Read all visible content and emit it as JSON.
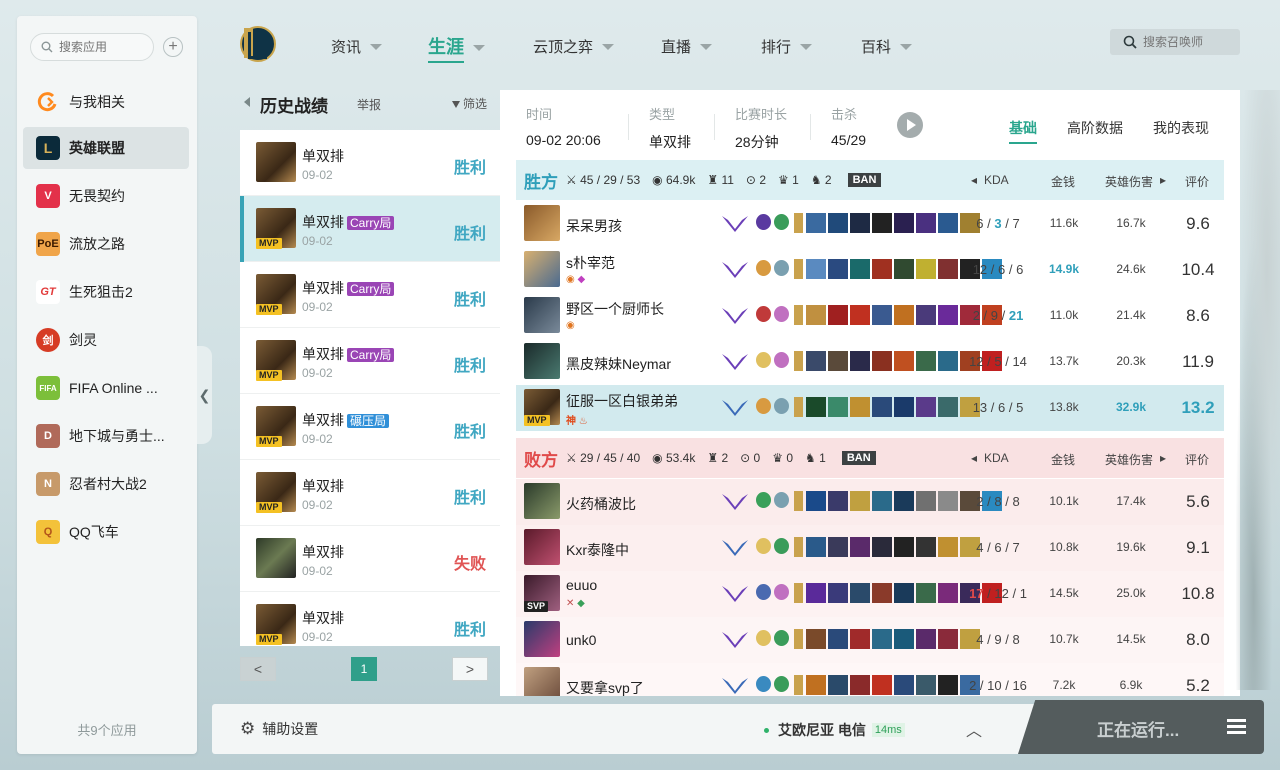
{
  "sidebar": {
    "search_placeholder": "搜索应用",
    "apps": [
      {
        "label": "与我相关",
        "icon": "ring-icon",
        "color": "#ff8a1e"
      },
      {
        "label": "英雄联盟",
        "icon": "lol-icon",
        "color": "#c8a24d"
      },
      {
        "label": "无畏契约",
        "icon": "valorant-icon",
        "color": "#e3314a"
      },
      {
        "label": "流放之路",
        "icon": "poe-icon",
        "color": "#e8a04a"
      },
      {
        "label": "生死狙击2",
        "icon": "sniper-icon",
        "color": "#e23b3b"
      },
      {
        "label": "剑灵",
        "icon": "blade-soul-icon",
        "color": "#d63c25"
      },
      {
        "label": "FIFA Online ...",
        "icon": "fifa-icon",
        "color": "#7cbf3a"
      },
      {
        "label": "地下城与勇士...",
        "icon": "dnf-icon",
        "color": "#b06a5a"
      },
      {
        "label": "忍者村大战2",
        "icon": "ninja-icon",
        "color": "#c79a6a"
      },
      {
        "label": "QQ飞车",
        "icon": "qqspeed-icon",
        "color": "#f3c23a"
      }
    ],
    "footer": "共9个应用"
  },
  "nav": {
    "items": [
      "资讯",
      "生涯",
      "云顶之弈",
      "直播",
      "排行",
      "百科"
    ],
    "active": "生涯",
    "search_placeholder": "搜索召唤师"
  },
  "history": {
    "title": "历史战绩",
    "report": "举报",
    "filter": "筛选",
    "matches": [
      {
        "type": "单双排",
        "tag": "",
        "date": "09-02",
        "result": "胜利",
        "mvp": false
      },
      {
        "type": "单双排",
        "tag": "Carry局",
        "date": "09-02",
        "result": "胜利",
        "mvp": true
      },
      {
        "type": "单双排",
        "tag": "Carry局",
        "date": "09-02",
        "result": "胜利",
        "mvp": true
      },
      {
        "type": "单双排",
        "tag": "Carry局",
        "date": "09-02",
        "result": "胜利",
        "mvp": true
      },
      {
        "type": "单双排",
        "tag": "碾压局",
        "date": "09-02",
        "result": "胜利",
        "mvp": true
      },
      {
        "type": "单双排",
        "tag": "",
        "date": "09-02",
        "result": "胜利",
        "mvp": true
      },
      {
        "type": "单双排",
        "tag": "",
        "date": "09-02",
        "result": "失败",
        "mvp": false
      },
      {
        "type": "单双排",
        "tag": "",
        "date": "09-02",
        "result": "胜利",
        "mvp": true
      }
    ],
    "page": "1",
    "prev": "<",
    "next": ">"
  },
  "detail": {
    "stats": [
      {
        "key": "时间",
        "value": "09-02 20:06"
      },
      {
        "key": "类型",
        "value": "单双排"
      },
      {
        "key": "比赛时长",
        "value": "28分钟"
      },
      {
        "key": "击杀",
        "value": "45/29"
      }
    ],
    "tabs": [
      "基础",
      "高阶数据",
      "我的表现"
    ],
    "active_tab": "基础",
    "columns": [
      "KDA",
      "金钱",
      "英雄伤害",
      "评价"
    ],
    "win": {
      "name": "胜方",
      "kda": "45 / 29 / 53",
      "gold": "64.9k",
      "towers": "11",
      "inhib": "2",
      "baron": "1",
      "dragon": "2",
      "ban": "BAN",
      "players": [
        {
          "name": "呆呆男孩",
          "k": "6",
          "d": "3",
          "a": "7",
          "gold": "11.6k",
          "dmg": "16.7k",
          "score": "9.6",
          "badge": ""
        },
        {
          "name": "s朴宰范",
          "k": "12",
          "d": "6",
          "a": "6",
          "gold": "14.9k",
          "dmg": "24.6k",
          "score": "10.4",
          "badge": ""
        },
        {
          "name": "野区一个厨师长",
          "k": "2",
          "d": "9",
          "a": "21",
          "gold": "11.0k",
          "dmg": "21.4k",
          "score": "8.6",
          "badge": ""
        },
        {
          "name": "黑皮辣妹Neymar",
          "k": "12",
          "d": "5",
          "a": "14",
          "gold": "13.7k",
          "dmg": "20.3k",
          "score": "11.9",
          "badge": ""
        },
        {
          "name": "征服一区白银弟弟",
          "k": "13",
          "d": "6",
          "a": "5",
          "gold": "13.8k",
          "dmg": "32.9k",
          "score": "13.2",
          "badge": "神"
        }
      ]
    },
    "lose": {
      "name": "败方",
      "kda": "29 / 45 / 40",
      "gold": "53.4k",
      "towers": "2",
      "inhib": "0",
      "baron": "0",
      "dragon": "1",
      "ban": "BAN",
      "players": [
        {
          "name": "火药桶波比",
          "k": "2",
          "d": "8",
          "a": "8",
          "gold": "10.1k",
          "dmg": "17.4k",
          "score": "5.6"
        },
        {
          "name": "Kxr泰隆中",
          "k": "4",
          "d": "6",
          "a": "7",
          "gold": "10.8k",
          "dmg": "19.6k",
          "score": "9.1"
        },
        {
          "name": "euuo",
          "k": "17",
          "d": "12",
          "a": "1",
          "gold": "14.5k",
          "dmg": "25.0k",
          "score": "10.8"
        },
        {
          "name": "unk0",
          "k": "4",
          "d": "9",
          "a": "8",
          "gold": "10.7k",
          "dmg": "14.5k",
          "score": "8.0"
        },
        {
          "name": "又要拿svp了",
          "k": "2",
          "d": "10",
          "a": "16",
          "gold": "7.2k",
          "dmg": "6.9k",
          "score": "5.2"
        }
      ]
    }
  },
  "bottom": {
    "settings": "辅助设置",
    "server": "艾欧尼亚 电信",
    "ping": "14ms",
    "running": "正在运行..."
  },
  "colors": {
    "accent": "#2aa68e",
    "win": "#2f9fba",
    "lose": "#e04a4a",
    "carry": "#9a45b5",
    "crush": "#2f8fd8"
  }
}
